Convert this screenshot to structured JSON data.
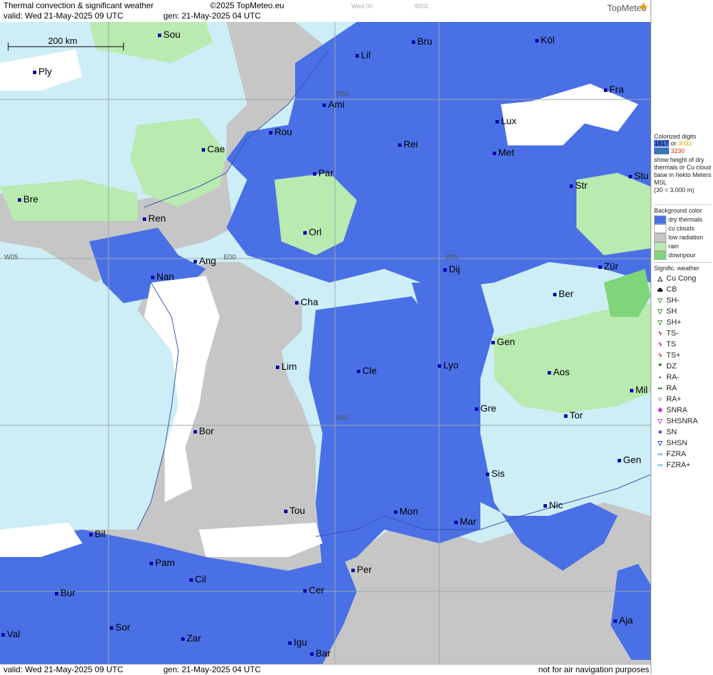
{
  "header": {
    "title": "Thermal convection & significant weather",
    "copyright": "©2025 TopMeteo.eu",
    "valid": "valid:  Wed  21-May-2025  09 UTC",
    "gen": "gen: 21-May-2025 04 UTC",
    "faint_1": "Wed 00",
    "faint_2": "9002",
    "logo": "TopMeteo"
  },
  "footer": {
    "valid": "valid:  Wed  21-May-2025  09 UTC",
    "gen": "gen: 21-May-2025 04 UTC",
    "disclaimer": "not for air navigation purposes"
  },
  "map": {
    "scale_label": "200 km",
    "meridians": [
      "W05",
      "E00",
      "E05",
      "N50",
      "N45"
    ],
    "cities": [
      "Sou",
      "Ply",
      "Lil",
      "Bru",
      "Köl",
      "Fra",
      "Ami",
      "Rou",
      "Cae",
      "Lux",
      "Rei",
      "Met",
      "Par",
      "Bre",
      "Str",
      "Stu",
      "Ren",
      "Orl",
      "Ang",
      "Zür",
      "Nan",
      "Dij",
      "Ber",
      "Cha",
      "Gen",
      "Lim",
      "Cle",
      "Lyo",
      "Aos",
      "Mil",
      "Gre",
      "Tor",
      "Bor",
      "Gen",
      "Sis",
      "Nic",
      "Tou",
      "Mon",
      "Mar",
      "Bil",
      "Per",
      "Pam",
      "Cil",
      "Bur",
      "Cer",
      "Sor",
      "Aja",
      "Val",
      "Zar",
      "Igu",
      "Bar"
    ],
    "colors": {
      "sea": "#cdeef6",
      "dry_thermals": "#4a70e6",
      "cu_clouds": "#ffffff",
      "low_radiation": "#c6c6c6",
      "rain": "#b9eab0",
      "downpour": "#7fd67a"
    }
  },
  "legend": {
    "colorized_title": "Colorized digits",
    "sample_a": "1817",
    "sample_or": "or",
    "sample_b": "3032",
    "sample_c": "2825",
    "sample_d": "3230",
    "colorized_desc": "show height of dry thermals or Cu cloud base in hekto Meters MSL",
    "colorized_note": "(30 = 3.000 m)",
    "bg_title": "Background color",
    "bg_items": [
      {
        "label": "dry thermals",
        "color": "#4a70e6"
      },
      {
        "label": "cu clouds",
        "color": "#ffffff"
      },
      {
        "label": "low radiation",
        "color": "#c6c6c6"
      },
      {
        "label": "rain",
        "color": "#b9eab0"
      },
      {
        "label": "downpour",
        "color": "#7fd67a"
      }
    ],
    "sig_title": "Signific. weather",
    "sig_items": [
      {
        "symbol": "△",
        "label": "Cu Cong",
        "color": "#000"
      },
      {
        "symbol": "⏏",
        "label": "CB",
        "color": "#000"
      },
      {
        "symbol": "▽",
        "label": "SH-",
        "color": "#1a8a1a"
      },
      {
        "symbol": "▽",
        "label": "SH",
        "color": "#1a8a1a"
      },
      {
        "symbol": "▽",
        "label": "SH+",
        "color": "#1a8a1a"
      },
      {
        "symbol": "ϟ",
        "label": "TS-",
        "color": "#d01010"
      },
      {
        "symbol": "ϟ",
        "label": "TS",
        "color": "#d01010"
      },
      {
        "symbol": "ϟ",
        "label": "TS+",
        "color": "#d01010"
      },
      {
        "symbol": "❞",
        "label": "DZ",
        "color": "#0a6a0a"
      },
      {
        "symbol": "•",
        "label": "RA-",
        "color": "#0a6a0a"
      },
      {
        "symbol": "••",
        "label": "RA",
        "color": "#0a6a0a"
      },
      {
        "symbol": "⁘",
        "label": "RA+",
        "color": "#0a6a0a"
      },
      {
        "symbol": "✱",
        "label": "SNRA",
        "color": "#c030d0"
      },
      {
        "symbol": "▽",
        "label": "SHSNRA",
        "color": "#c030d0"
      },
      {
        "symbol": "✶",
        "label": "SN",
        "color": "#1030c0"
      },
      {
        "symbol": "▽",
        "label": "SHSN",
        "color": "#1030c0"
      },
      {
        "symbol": "∾",
        "label": "FZRA",
        "color": "#20b0e0"
      },
      {
        "symbol": "∾",
        "label": "FZRA+",
        "color": "#20b0e0"
      }
    ]
  }
}
